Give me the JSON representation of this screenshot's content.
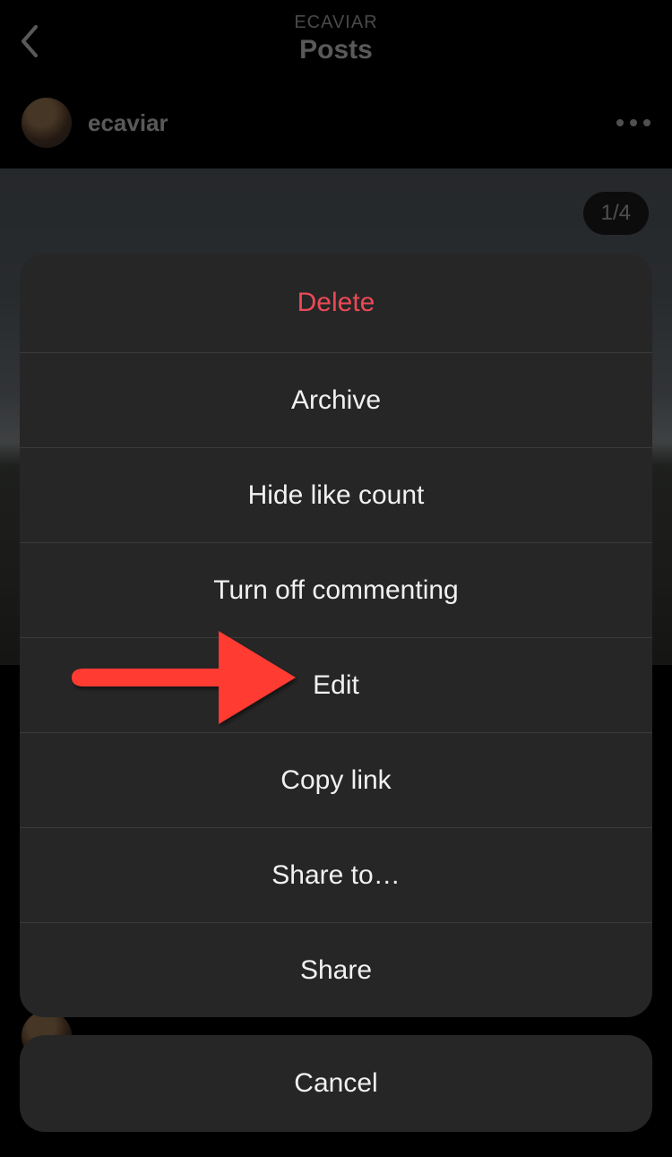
{
  "header": {
    "username_upper": "ECAVIAR",
    "title": "Posts"
  },
  "post": {
    "username": "ecaviar",
    "counter": "1/4"
  },
  "sheet": {
    "items": [
      {
        "label": "Delete",
        "destructive": true
      },
      {
        "label": "Archive",
        "destructive": false
      },
      {
        "label": "Hide like count",
        "destructive": false
      },
      {
        "label": "Turn off commenting",
        "destructive": false
      },
      {
        "label": "Edit",
        "destructive": false
      },
      {
        "label": "Copy link",
        "destructive": false
      },
      {
        "label": "Share to…",
        "destructive": false
      },
      {
        "label": "Share",
        "destructive": false
      }
    ],
    "cancel": "Cancel"
  },
  "annotation": {
    "arrow_color": "#ff3b30"
  }
}
